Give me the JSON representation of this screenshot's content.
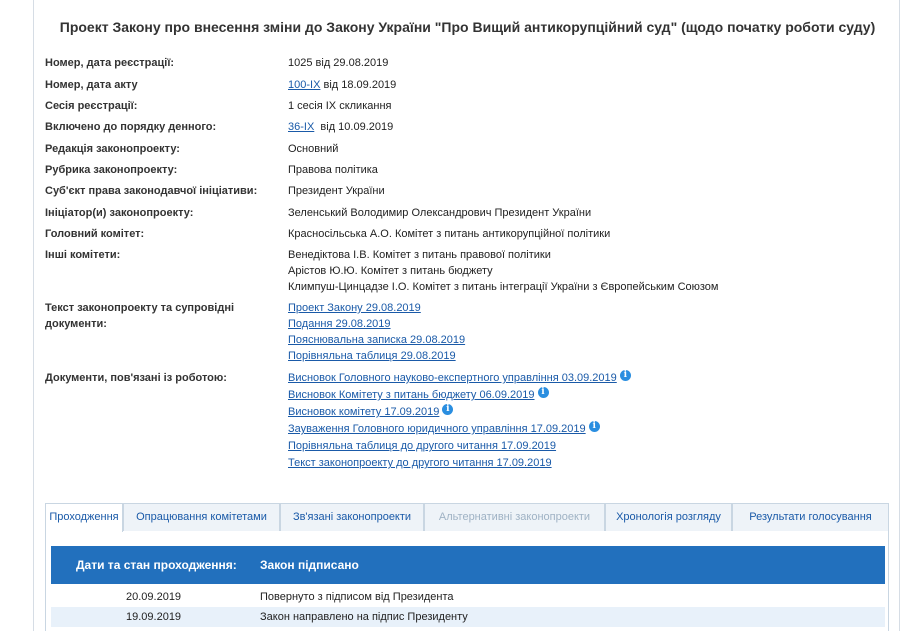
{
  "title": "Проект Закону про внесення зміни до Закону України \"Про Вищий антикорупційний суд\" (щодо початку роботи суду)",
  "fields": {
    "reg": {
      "label": "Номер, дата реєстрації:",
      "value": "1025 від 29.08.2019"
    },
    "act": {
      "label": "Номер, дата акту",
      "link": "100-IX",
      "suffix": " від 18.09.2019"
    },
    "session": {
      "label": "Сесія реєстрації:",
      "value": "1 сесія IX скликання"
    },
    "agenda": {
      "label": "Включено до порядку денного:",
      "link": "36-IX",
      "suffix": "  від 10.09.2019"
    },
    "edition": {
      "label": "Редакція законопроекту:",
      "value": "Основний"
    },
    "rubric": {
      "label": "Рубрика законопроекту:",
      "value": "Правова політика"
    },
    "subject": {
      "label": "Суб'єкт права законодавчої ініціативи:",
      "value": "Президент України"
    },
    "initiator": {
      "label": "Ініціатор(и) законопроекту:",
      "value": "Зеленський Володимир Олександрович Президент України"
    },
    "main_committee": {
      "label": "Головний комітет:",
      "value": "Красносільська А.О. Комітет з питань антикорупційної політики"
    },
    "other_committees": {
      "label": "Інші комітети:",
      "items": [
        "Венедіктова І.В. Комітет з питань правової політики",
        "Арістов Ю.Ю. Комітет з питань бюджету",
        "Климпуш-Цинцадзе І.О. Комітет з питань інтеграції України з Європейським Союзом"
      ]
    },
    "texts": {
      "label_line1": "Текст законопроекту та супровідні",
      "label_line2": "документи:",
      "items": [
        "Проект Закону 29.08.2019",
        "Подання 29.08.2019",
        "Пояснювальна записка 29.08.2019",
        "Порівняльна таблиця 29.08.2019"
      ]
    },
    "docs": {
      "label": "Документи, пов'язані із роботою:",
      "items": [
        {
          "text": "Висновок Головного науково-експертного управління 03.09.2019",
          "info": true
        },
        {
          "text": "Висновок Комітету з питань бюджету 06.09.2019",
          "info": true
        },
        {
          "text": "Висновок комітету 17.09.2019",
          "info": true
        },
        {
          "text": "Зауваження Головного юридичного управління 17.09.2019",
          "info": true
        },
        {
          "text": "Порівняльна таблиця до другого читання 17.09.2019",
          "info": false
        },
        {
          "text": "Текст законопроекту до другого читання 17.09.2019",
          "info": false
        }
      ]
    }
  },
  "info_glyph": "i",
  "tabs": [
    {
      "label": "Проходження",
      "state": "active"
    },
    {
      "label": "Опрацювання комітетами",
      "state": "normal"
    },
    {
      "label": "Зв'язані законопроекти",
      "state": "normal"
    },
    {
      "label": "Альтернативні законопроекти",
      "state": "disabled"
    },
    {
      "label": "Хронологія розгляду",
      "state": "normal"
    },
    {
      "label": "Результати голосування",
      "state": "normal"
    }
  ],
  "status": {
    "label": "Дати та стан проходження:",
    "value": "Закон підписано"
  },
  "history": [
    {
      "date": "20.09.2019",
      "event": "Повернуто з підписом від Президента"
    },
    {
      "date": "19.09.2019",
      "event": "Закон направлено на підпис Президенту"
    }
  ],
  "colors": {
    "link": "#1a5aa8",
    "header_bar": "#2270bd",
    "info_icon": "#2a8ee0",
    "alt_row": "#e8f1fa"
  }
}
